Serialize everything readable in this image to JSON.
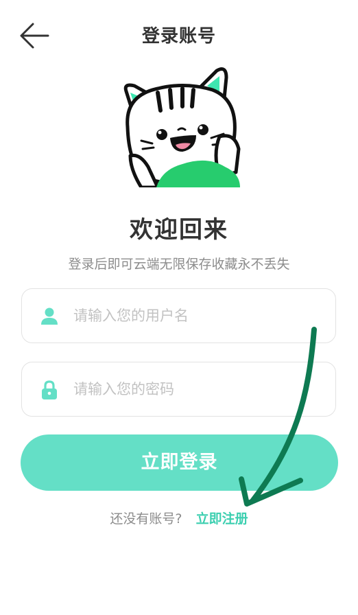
{
  "header": {
    "title": "登录账号",
    "back_icon": "arrow-left-icon"
  },
  "welcome": {
    "title": "欢迎回来",
    "subtitle": "登录后即可云端无限保存收藏永不丢失"
  },
  "form": {
    "username": {
      "icon": "user-icon",
      "placeholder": "请输入您的用户名",
      "value": ""
    },
    "password": {
      "icon": "lock-icon",
      "placeholder": "请输入您的密码",
      "value": ""
    },
    "login_label": "立即登录"
  },
  "register": {
    "prompt": "还没有账号?",
    "link_label": "立即注册"
  },
  "colors": {
    "accent": "#64dfc6",
    "link": "#3ccfb0",
    "annotation_arrow": "#0e7a52"
  }
}
